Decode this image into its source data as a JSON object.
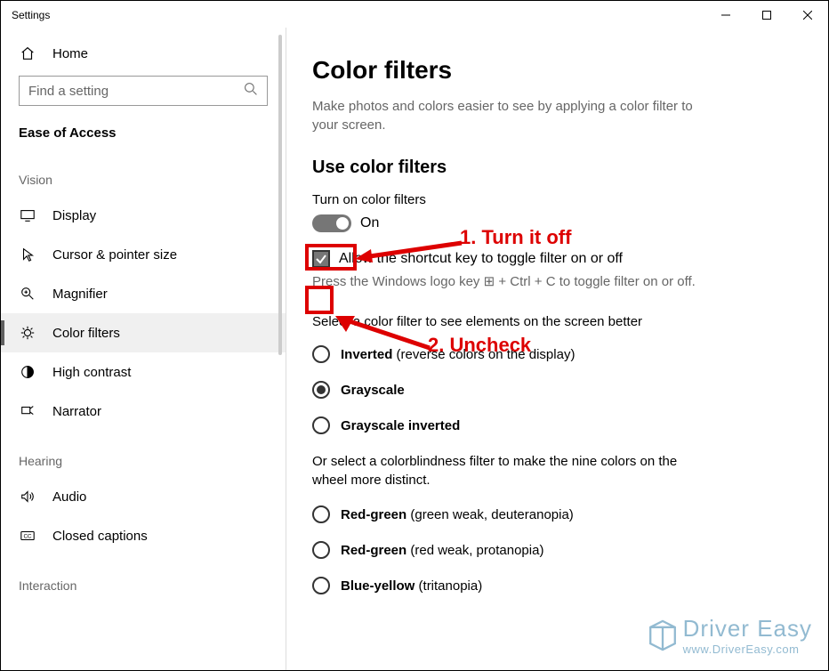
{
  "window": {
    "title": "Settings"
  },
  "sidebar": {
    "home": "Home",
    "search_placeholder": "Find a setting",
    "category": "Ease of Access",
    "groups": {
      "vision": {
        "label": "Vision",
        "items": [
          {
            "label": "Display"
          },
          {
            "label": "Cursor & pointer size"
          },
          {
            "label": "Magnifier"
          },
          {
            "label": "Color filters",
            "selected": true
          },
          {
            "label": "High contrast"
          },
          {
            "label": "Narrator"
          }
        ]
      },
      "hearing": {
        "label": "Hearing",
        "items": [
          {
            "label": "Audio"
          },
          {
            "label": "Closed captions"
          }
        ]
      },
      "interaction": {
        "label": "Interaction"
      }
    }
  },
  "main": {
    "title": "Color filters",
    "description": "Make photos and colors easier to see by applying a color filter to your screen.",
    "section": "Use color filters",
    "toggle_label": "Turn on color filters",
    "toggle_state": "On",
    "checkbox_label": "Allow the shortcut key to toggle filter on or off",
    "hint_pre": "Press the Windows logo key ",
    "hint_post": " + Ctrl + C to toggle filter on or off.",
    "filter_intro": "Select a color filter to see elements on the screen better",
    "filters": [
      {
        "bold": "Inverted",
        "rest": " (reverse colors on the display)",
        "selected": false
      },
      {
        "bold": "Grayscale",
        "rest": "",
        "selected": true
      },
      {
        "bold": "Grayscale inverted",
        "rest": "",
        "selected": false
      }
    ],
    "cb_intro": "Or select a colorblindness filter to make the nine colors on the wheel more distinct.",
    "cb_filters": [
      {
        "bold": "Red-green",
        "rest": " (green weak, deuteranopia)"
      },
      {
        "bold": "Red-green",
        "rest": " (red weak, protanopia)"
      },
      {
        "bold": "Blue-yellow",
        "rest": " (tritanopia)"
      }
    ]
  },
  "annotations": {
    "text1": "1. Turn it off",
    "text2": "2. Uncheck"
  },
  "watermark": {
    "line1": "Driver Easy",
    "line2": "www.DriverEasy.com"
  }
}
